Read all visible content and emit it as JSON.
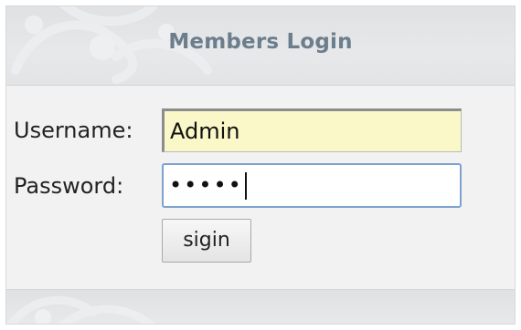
{
  "login_panel": {
    "title": "Members Login",
    "username_label": "Username:",
    "username_value": "Admin",
    "password_label": "Password:",
    "password_mask": "•••••",
    "signin_label": "sigin"
  },
  "colors": {
    "title": "#6c7d8c",
    "username_field_bg": "#faf7c8",
    "password_focus_border": "#7da2ce"
  },
  "icons": {
    "header_decoration": "swirl-ornament",
    "footer_decoration": "swirl-ornament"
  }
}
